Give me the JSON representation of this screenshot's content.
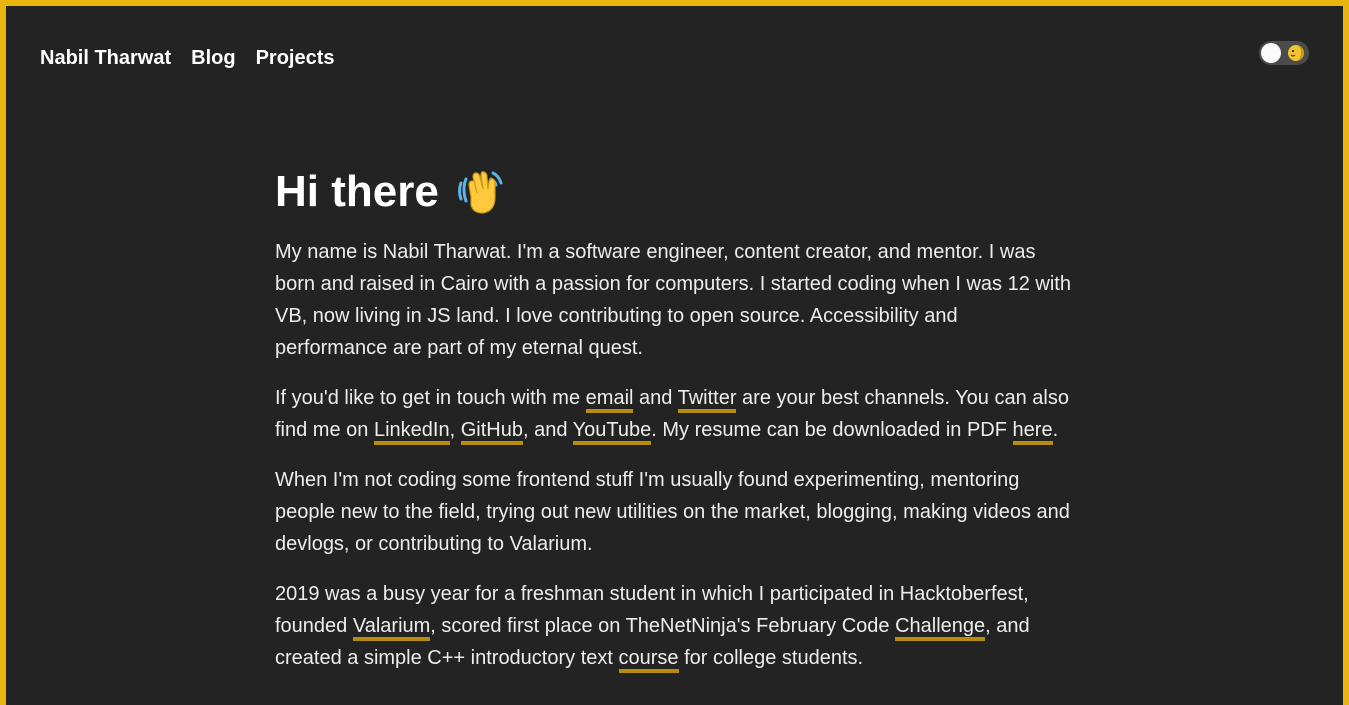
{
  "nav": {
    "brand": "Nabil Tharwat",
    "blog": "Blog",
    "projects": "Projects"
  },
  "theme_toggle": {
    "state": "dark",
    "icon": "moon-icon"
  },
  "main": {
    "heading": "Hi there",
    "heading_icon": "waving-hand-icon",
    "p1": "My name is Nabil Tharwat. I'm a software engineer, content creator, and mentor. I was born and raised in Cairo with a passion for computers. I started coding when I was 12 with VB, now living in JS land. I love contributing to open source. Accessibility and performance are part of my eternal quest.",
    "p2": {
      "t1": "If you'd like to get in touch with me ",
      "l_email": "email",
      "t2": " and ",
      "l_twitter": "Twitter",
      "t3": " are your best channels. You can also find me on ",
      "l_linkedin": "LinkedIn",
      "t4": ", ",
      "l_github": "GitHub",
      "t5": ", and ",
      "l_youtube": "YouTube",
      "t6": ". My resume can be downloaded in PDF ",
      "l_here": "here",
      "t7": "."
    },
    "p3": "When I'm not coding some frontend stuff I'm usually found experimenting, mentoring people new to the field, trying out new utilities on the market, blogging, making videos and devlogs, or contributing to Valarium.",
    "p4": {
      "t1": "2019 was a busy year for a freshman student in which I participated in Hacktoberfest, founded ",
      "l_valarium": "Valarium",
      "t2": ", scored first place on TheNetNinja's February Code ",
      "l_challenge": "Challenge",
      "t3": ", and created a simple C++ introductory text ",
      "l_course": "course",
      "t4": " for college students."
    }
  },
  "colors": {
    "frame": "#e8b50f",
    "background": "#232323",
    "link_underline": "#b78c0f",
    "text": "#ededed"
  }
}
